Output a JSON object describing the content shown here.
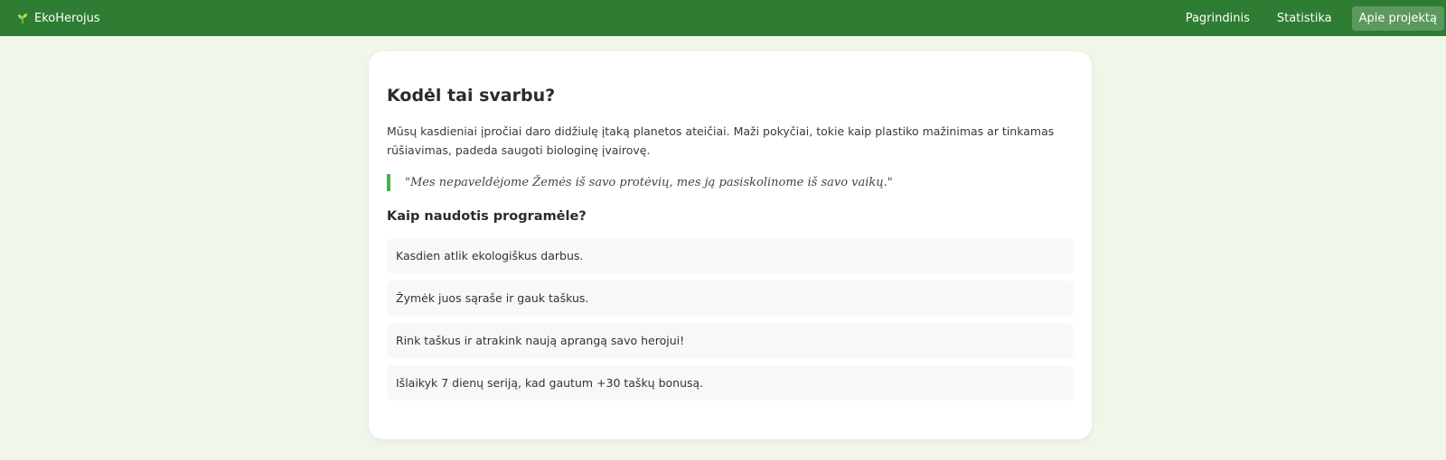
{
  "navbar": {
    "brand": "EkoHerojus",
    "links": [
      {
        "label": "Pagrindinis",
        "active": false
      },
      {
        "label": "Statistika",
        "active": false
      },
      {
        "label": "Apie projektą",
        "active": true
      }
    ]
  },
  "content": {
    "title": "Kodėl tai svarbu?",
    "intro": "Mūsų kasdieniai įpročiai daro didžiulę įtaką planetos ateičiai. Maži pokyčiai, tokie kaip plastiko mažinimas ar tinkamas rūšiavimas, padeda saugoti biologinę įvairovę.",
    "quote": "\"Mes nepaveldėjome Žemės iš savo protėvių, mes ją pasiskolinome iš savo vaikų.\"",
    "how_to_title": "Kaip naudotis programėle?",
    "steps": [
      "Kasdien atlik ekologiškus darbus.",
      "Žymėk juos sąraše ir gauk taškus.",
      "Rink taškus ir atrakink naują aprangą savo herojui!",
      "Išlaikyk 7 dienų seriją, kad gautum +30 taškų bonusą."
    ]
  },
  "colors": {
    "navbar": "#2e7d32",
    "accent": "#4caf50",
    "background": "#f1f6ea"
  },
  "icons": {
    "brand": "sprout-icon"
  }
}
